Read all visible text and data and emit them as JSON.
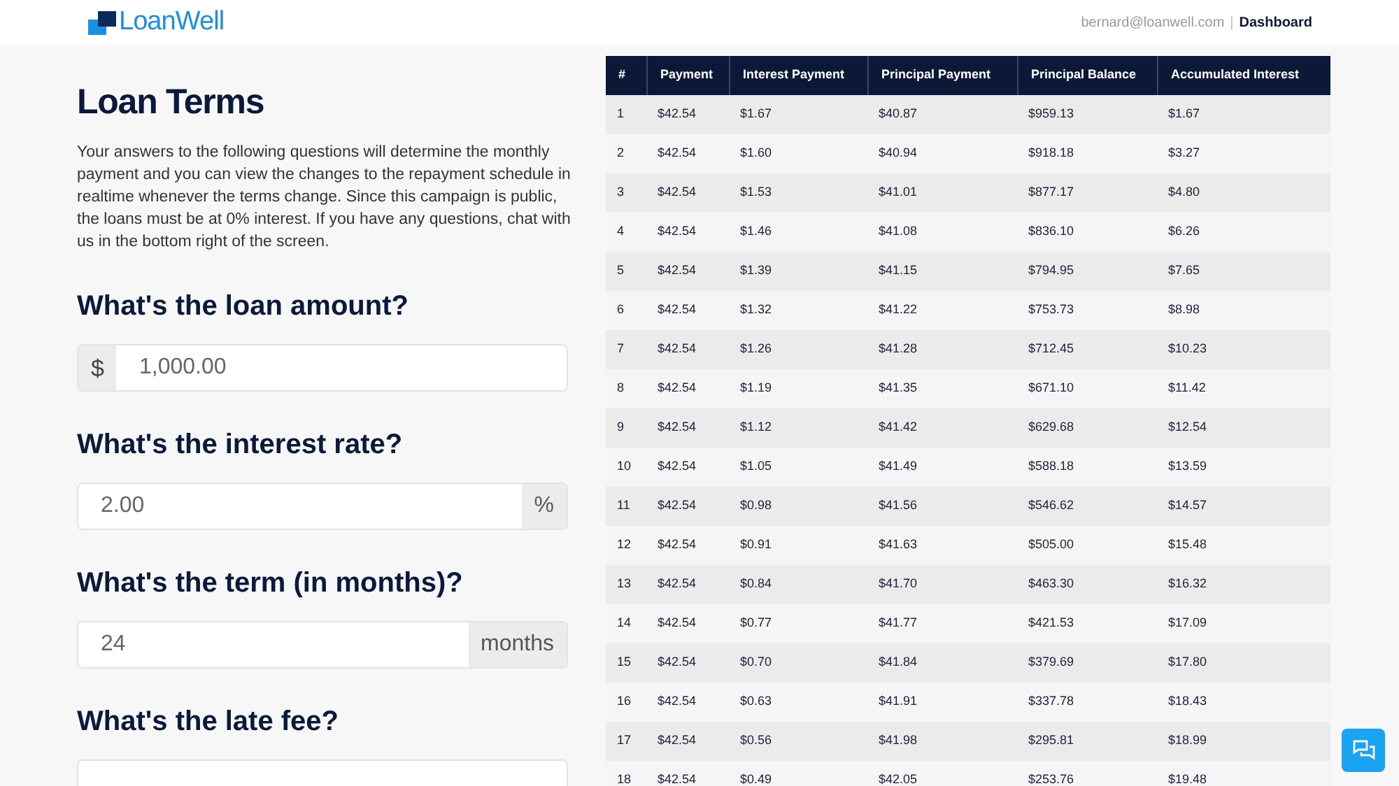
{
  "header": {
    "logo": "LoanWell",
    "user_email": "bernard@loanwell.com",
    "separator": "|",
    "nav_link": "Dashboard"
  },
  "form": {
    "title": "Loan Terms",
    "intro": "Your answers to the following questions will determine the monthly payment and you can view the changes to the repayment schedule in realtime whenever the terms change. Since this campaign is public, the loans must be at 0% interest. If you have any questions, chat with us in the bottom right of the screen.",
    "questions": [
      {
        "label": "What's the loan amount?",
        "value": "1,000.00",
        "prefix": "$"
      },
      {
        "label": "What's the interest rate?",
        "value": "2.00",
        "suffix": "%"
      },
      {
        "label": "What's the term (in months)?",
        "value": "24",
        "suffix": "months"
      },
      {
        "label": "What's the late fee?"
      }
    ]
  },
  "table": {
    "columns": [
      "#",
      "Payment",
      "Interest Payment",
      "Principal Payment",
      "Principal Balance",
      "Accumulated Interest"
    ],
    "rows": [
      [
        "1",
        "$42.54",
        "$1.67",
        "$40.87",
        "$959.13",
        "$1.67"
      ],
      [
        "2",
        "$42.54",
        "$1.60",
        "$40.94",
        "$918.18",
        "$3.27"
      ],
      [
        "3",
        "$42.54",
        "$1.53",
        "$41.01",
        "$877.17",
        "$4.80"
      ],
      [
        "4",
        "$42.54",
        "$1.46",
        "$41.08",
        "$836.10",
        "$6.26"
      ],
      [
        "5",
        "$42.54",
        "$1.39",
        "$41.15",
        "$794.95",
        "$7.65"
      ],
      [
        "6",
        "$42.54",
        "$1.32",
        "$41.22",
        "$753.73",
        "$8.98"
      ],
      [
        "7",
        "$42.54",
        "$1.26",
        "$41.28",
        "$712.45",
        "$10.23"
      ],
      [
        "8",
        "$42.54",
        "$1.19",
        "$41.35",
        "$671.10",
        "$11.42"
      ],
      [
        "9",
        "$42.54",
        "$1.12",
        "$41.42",
        "$629.68",
        "$12.54"
      ],
      [
        "10",
        "$42.54",
        "$1.05",
        "$41.49",
        "$588.18",
        "$13.59"
      ],
      [
        "11",
        "$42.54",
        "$0.98",
        "$41.56",
        "$546.62",
        "$14.57"
      ],
      [
        "12",
        "$42.54",
        "$0.91",
        "$41.63",
        "$505.00",
        "$15.48"
      ],
      [
        "13",
        "$42.54",
        "$0.84",
        "$41.70",
        "$463.30",
        "$16.32"
      ],
      [
        "14",
        "$42.54",
        "$0.77",
        "$41.77",
        "$421.53",
        "$17.09"
      ],
      [
        "15",
        "$42.54",
        "$0.70",
        "$41.84",
        "$379.69",
        "$17.80"
      ],
      [
        "16",
        "$42.54",
        "$0.63",
        "$41.91",
        "$337.78",
        "$18.43"
      ],
      [
        "17",
        "$42.54",
        "$0.56",
        "$41.98",
        "$295.81",
        "$18.99"
      ],
      [
        "18",
        "$42.54",
        "$0.49",
        "$42.05",
        "$253.76",
        "$19.48"
      ]
    ]
  }
}
